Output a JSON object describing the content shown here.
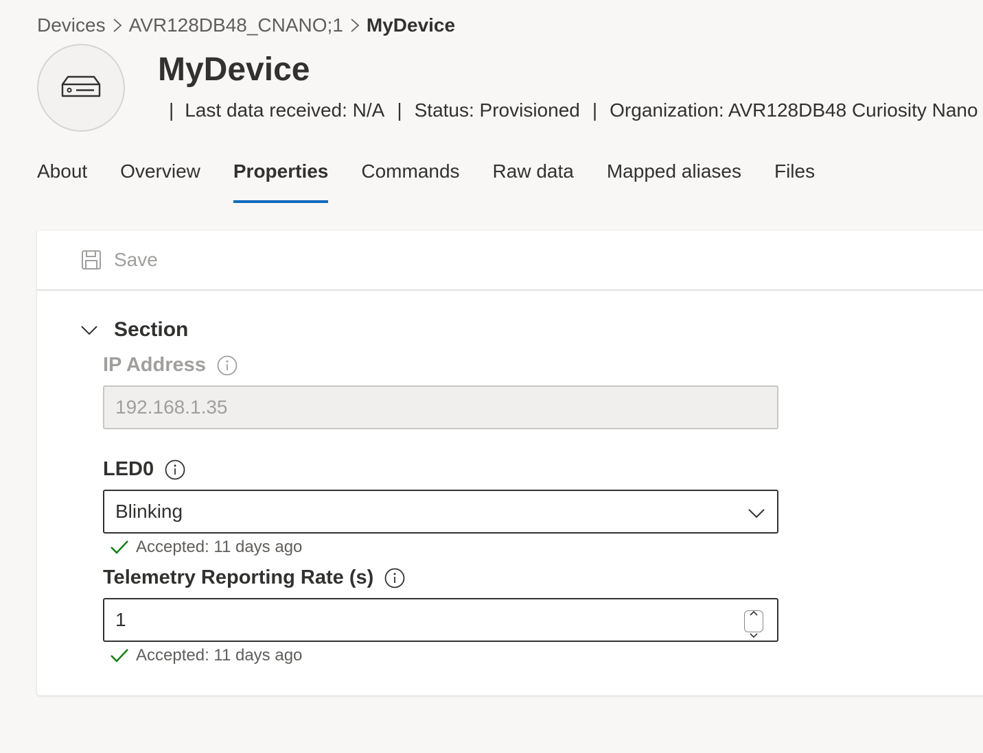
{
  "breadcrumb": {
    "items": [
      "Devices",
      "AVR128DB48_CNANO;1",
      "MyDevice"
    ]
  },
  "device": {
    "name": "MyDevice",
    "last_data_label": "Last data received: N/A",
    "status_label": "Status: Provisioned",
    "organization_label": "Organization: AVR128DB48 Curiosity Nano"
  },
  "tabs": [
    {
      "label": "About"
    },
    {
      "label": "Overview"
    },
    {
      "label": "Properties"
    },
    {
      "label": "Commands"
    },
    {
      "label": "Raw data"
    },
    {
      "label": "Mapped aliases"
    },
    {
      "label": "Files"
    }
  ],
  "active_tab": "Properties",
  "toolbar": {
    "save_label": "Save"
  },
  "section": {
    "title": "Section",
    "ip": {
      "label": "IP Address",
      "value": "192.168.1.35"
    },
    "led0": {
      "label": "LED0",
      "value": "Blinking",
      "status": "Accepted: 11 days ago"
    },
    "telemetry": {
      "label": "Telemetry Reporting Rate (s)",
      "value": "1",
      "status": "Accepted: 11 days ago"
    }
  },
  "colors": {
    "accent": "#0f6cbd",
    "success": "#107c10",
    "page_background": "#f8f7f6"
  },
  "icons": [
    "device-icon",
    "chevron-right-icon",
    "save-icon",
    "chevron-down-icon",
    "info-icon",
    "checkmark-icon",
    "spin-up-icon",
    "spin-down-icon"
  ]
}
